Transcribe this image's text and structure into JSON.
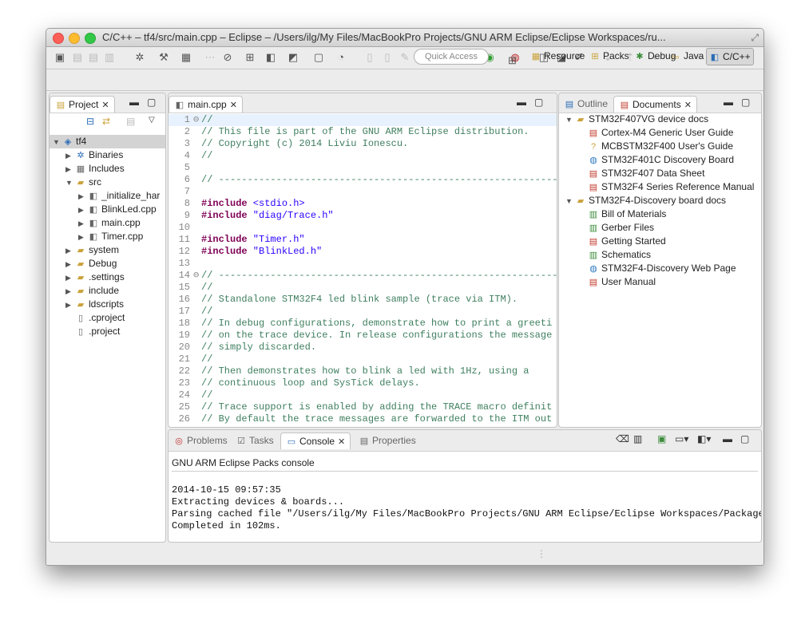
{
  "window": {
    "title": "C/C++ – tf4/src/main.cpp – Eclipse – /Users/ilg/My Files/MacBookPro Projects/GNU ARM Eclipse/Eclipse Workspaces/ru..."
  },
  "toolbar": {
    "quick_access_placeholder": "Quick Access"
  },
  "perspectives": [
    {
      "label": "Resource",
      "icon": "resource-icon"
    },
    {
      "label": "Packs",
      "icon": "packs-icon"
    },
    {
      "label": "Debug",
      "icon": "debug-icon"
    },
    {
      "label": "Java",
      "icon": "java-icon"
    },
    {
      "label": "C/C++",
      "icon": "cpp-icon"
    }
  ],
  "project_panel": {
    "tab_label": "Project",
    "tree": [
      {
        "label": "tf4",
        "level": 0,
        "twisty": "▼",
        "icon": "project",
        "selected": true
      },
      {
        "label": "Binaries",
        "level": 1,
        "twisty": "▶",
        "icon": "binaries"
      },
      {
        "label": "Includes",
        "level": 1,
        "twisty": "▶",
        "icon": "includes"
      },
      {
        "label": "src",
        "level": 1,
        "twisty": "▼",
        "icon": "folder"
      },
      {
        "label": "_initialize_har",
        "level": 2,
        "twisty": "▶",
        "icon": "cfile"
      },
      {
        "label": "BlinkLed.cpp",
        "level": 2,
        "twisty": "▶",
        "icon": "cfile"
      },
      {
        "label": "main.cpp",
        "level": 2,
        "twisty": "▶",
        "icon": "cfile"
      },
      {
        "label": "Timer.cpp",
        "level": 2,
        "twisty": "▶",
        "icon": "cfile"
      },
      {
        "label": "system",
        "level": 1,
        "twisty": "▶",
        "icon": "folder"
      },
      {
        "label": "Debug",
        "level": 1,
        "twisty": "▶",
        "icon": "folder"
      },
      {
        "label": ".settings",
        "level": 1,
        "twisty": "▶",
        "icon": "folder"
      },
      {
        "label": "include",
        "level": 1,
        "twisty": "▶",
        "icon": "folder"
      },
      {
        "label": "ldscripts",
        "level": 1,
        "twisty": "▶",
        "icon": "folder"
      },
      {
        "label": ".cproject",
        "level": 1,
        "twisty": "",
        "icon": "file"
      },
      {
        "label": ".project",
        "level": 1,
        "twisty": "",
        "icon": "file"
      }
    ]
  },
  "editor": {
    "tab_label": "main.cpp",
    "lines": [
      {
        "n": "1",
        "text": "//",
        "kind": "cm",
        "fold": "⊖"
      },
      {
        "n": "2",
        "text": "// This file is part of the GNU ARM Eclipse distribution.",
        "kind": "cm"
      },
      {
        "n": "3",
        "text": "// Copyright (c) 2014 Liviu Ionescu.",
        "kind": "cm"
      },
      {
        "n": "4",
        "text": "//",
        "kind": "cm"
      },
      {
        "n": "5",
        "text": "",
        "kind": "cm"
      },
      {
        "n": "6",
        "text": "// ----------------------------------------------------------------------------",
        "kind": "cm"
      },
      {
        "n": "7",
        "text": "",
        "kind": "cm"
      },
      {
        "n": "8",
        "directive": "#include",
        "arg": " <stdio.h>",
        "kind": "pp"
      },
      {
        "n": "9",
        "directive": "#include",
        "arg": " \"diag/Trace.h\"",
        "kind": "pp"
      },
      {
        "n": "10",
        "text": "",
        "kind": "cm"
      },
      {
        "n": "11",
        "directive": "#include",
        "arg": " \"Timer.h\"",
        "kind": "pp"
      },
      {
        "n": "12",
        "directive": "#include",
        "arg": " \"BlinkLed.h\"",
        "kind": "pp"
      },
      {
        "n": "13",
        "text": "",
        "kind": "cm"
      },
      {
        "n": "14",
        "text": "// ----------------------------------------------------------------------------",
        "kind": "cm",
        "fold": "⊖"
      },
      {
        "n": "15",
        "text": "//",
        "kind": "cm"
      },
      {
        "n": "16",
        "text": "// Standalone STM32F4 led blink sample (trace via ITM).",
        "kind": "cm"
      },
      {
        "n": "17",
        "text": "//",
        "kind": "cm"
      },
      {
        "n": "18",
        "text": "// In debug configurations, demonstrate how to print a greeti",
        "kind": "cm"
      },
      {
        "n": "19",
        "text": "// on the trace device. In release configurations the message",
        "kind": "cm"
      },
      {
        "n": "20",
        "text": "// simply discarded.",
        "kind": "cm"
      },
      {
        "n": "21",
        "text": "//",
        "kind": "cm"
      },
      {
        "n": "22",
        "text": "// Then demonstrates how to blink a led with 1Hz, using a",
        "kind": "cm"
      },
      {
        "n": "23",
        "text": "// continuous loop and SysTick delays.",
        "kind": "cm"
      },
      {
        "n": "24",
        "text": "//",
        "kind": "cm"
      },
      {
        "n": "25",
        "text": "// Trace support is enabled by adding the TRACE macro definit",
        "kind": "cm"
      },
      {
        "n": "26",
        "text": "// By default the trace messages are forwarded to the ITM out",
        "kind": "cm"
      }
    ]
  },
  "docs_panel": {
    "outline_label": "Outline",
    "documents_label": "Documents",
    "tree": [
      {
        "label": "STM32F407VG device docs",
        "level": 0,
        "twisty": "▼",
        "icon": "folder"
      },
      {
        "label": "Cortex-M4 Generic User Guide",
        "level": 1,
        "icon": "pdf"
      },
      {
        "label": "MCBSTM32F400 User's Guide",
        "level": 1,
        "icon": "unknown"
      },
      {
        "label": "STM32F401C Discovery Board",
        "level": 1,
        "icon": "web"
      },
      {
        "label": "STM32F407 Data Sheet",
        "level": 1,
        "icon": "pdf"
      },
      {
        "label": "STM32F4 Series Reference Manual",
        "level": 1,
        "icon": "pdf"
      },
      {
        "label": "STM32F4-Discovery board docs",
        "level": 0,
        "twisty": "▼",
        "icon": "folder"
      },
      {
        "label": "Bill of Materials",
        "level": 1,
        "icon": "xls"
      },
      {
        "label": "Gerber Files",
        "level": 1,
        "icon": "xls"
      },
      {
        "label": "Getting Started",
        "level": 1,
        "icon": "pdf"
      },
      {
        "label": "Schematics",
        "level": 1,
        "icon": "xls"
      },
      {
        "label": "STM32F4-Discovery Web Page",
        "level": 1,
        "icon": "web"
      },
      {
        "label": "User Manual",
        "level": 1,
        "icon": "pdf"
      }
    ]
  },
  "console_panel": {
    "tabs": [
      "Problems",
      "Tasks",
      "Console",
      "Properties"
    ],
    "active_tab": "Console",
    "console_name": "GNU ARM Eclipse Packs console",
    "output": [
      "",
      "2014-10-15 09:57:35",
      "Extracting devices & boards...",
      "Parsing cached file \"/Users/ilg/My Files/MacBookPro Projects/GNU ARM Eclipse/Eclipse Workspaces/Packages/",
      "Completed in 102ms."
    ]
  }
}
